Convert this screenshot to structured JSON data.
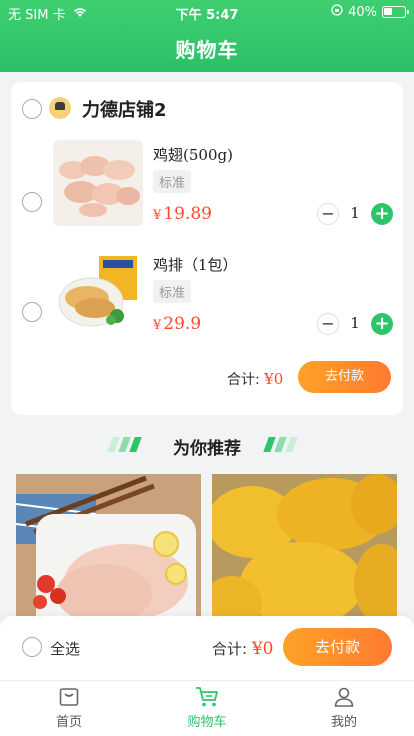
{
  "status_bar": {
    "carrier": "无 SIM 卡",
    "time": "下午 5:47",
    "battery": "40%"
  },
  "header": {
    "title": "购物车"
  },
  "store": {
    "name": "力德店铺2"
  },
  "items": [
    {
      "name": "鸡翅(500g)",
      "spec": "标准",
      "currency": "¥",
      "price": "19.89",
      "quantity": "1"
    },
    {
      "name": "鸡排（1包）",
      "spec": "标准",
      "currency": "¥",
      "price": "29.9",
      "quantity": "1"
    }
  ],
  "card_footer": {
    "total_label": "合计:",
    "total_value": "¥0",
    "pay_label": "去付款"
  },
  "recommend": {
    "title": "为你推荐"
  },
  "checkout": {
    "select_all_label": "全选",
    "total_label": "合计:",
    "total_value": "¥0",
    "pay_label": "去付款"
  },
  "tabbar": {
    "tabs": [
      {
        "label": "首页"
      },
      {
        "label": "购物车"
      },
      {
        "label": "我的"
      }
    ]
  },
  "colors": {
    "brand_green": "#2ec46a",
    "price_red": "#ff4a2a",
    "pay_orange": "#ff8a2c"
  },
  "icons": [
    "wifi-icon",
    "orientation-lock-icon",
    "battery-icon",
    "store-logo-icon",
    "shopping-bag-icon",
    "cart-icon",
    "user-icon"
  ]
}
